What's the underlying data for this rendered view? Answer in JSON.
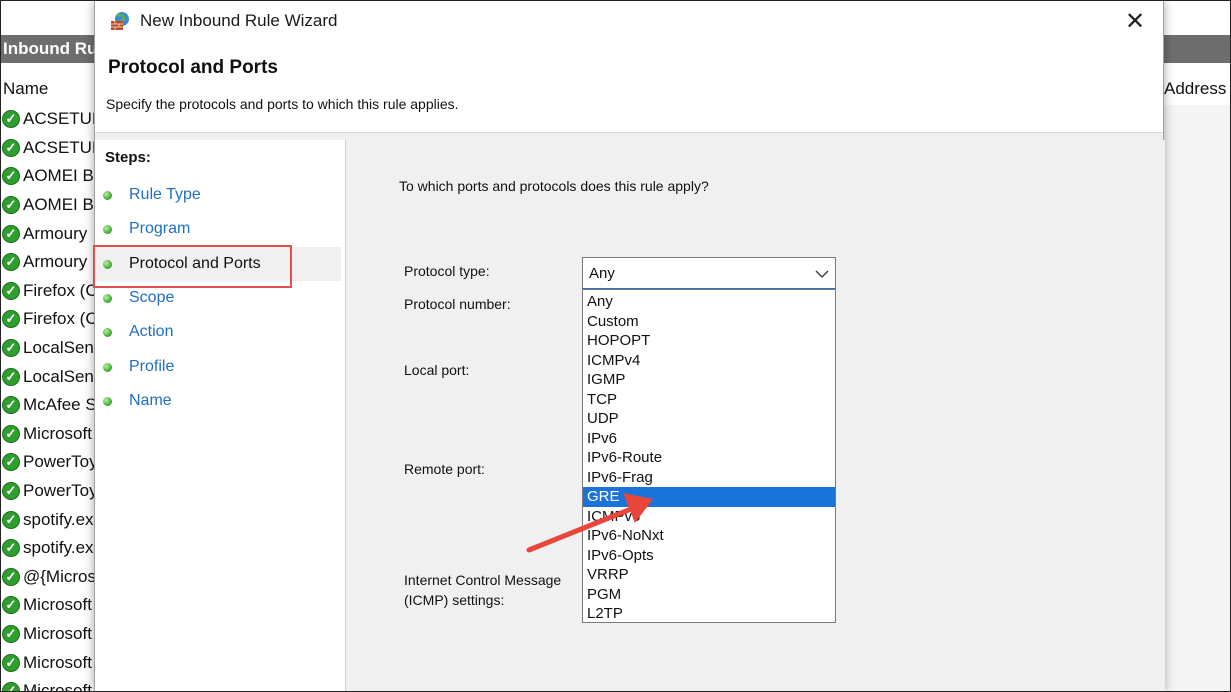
{
  "background": {
    "panel_title": "Inbound Ru",
    "columns": {
      "name": "Name",
      "address": "Address"
    },
    "rows": [
      "ACSETUP",
      "ACSETUP",
      "AOMEI Ba",
      "AOMEI Ba",
      "Armoury",
      "Armoury",
      "Firefox (C",
      "Firefox (C",
      "LocalSend",
      "LocalSend",
      "McAfee S",
      "Microsoft",
      "PowerToy",
      "PowerToy",
      "spotify.ex",
      "spotify.ex",
      "@{Micros",
      "Microsoft",
      "Microsoft",
      "Microsoft",
      "Microsoft"
    ],
    "check_icon": "check-shield-icon"
  },
  "dialog": {
    "window_title": "New Inbound Rule Wizard",
    "close_glyph": "✕",
    "page_title": "Protocol and Ports",
    "page_subtitle": "Specify the protocols and ports to which this rule applies."
  },
  "steps": {
    "title": "Steps:",
    "items": [
      "Rule Type",
      "Program",
      "Protocol and Ports",
      "Scope",
      "Action",
      "Profile",
      "Name"
    ],
    "current": "Protocol and Ports"
  },
  "main": {
    "question": "To which ports and protocols does this rule apply?",
    "labels": {
      "protocol_type": "Protocol type:",
      "protocol_number": "Protocol number:",
      "local_port": "Local port:",
      "remote_port": "Remote port:",
      "icmp_line1": "Internet Control Message",
      "icmp_line2": "(ICMP) settings:"
    },
    "protocol_select": {
      "value": "Any",
      "options": [
        "Any",
        "Custom",
        "HOPOPT",
        "ICMPv4",
        "IGMP",
        "TCP",
        "UDP",
        "IPv6",
        "IPv6-Route",
        "IPv6-Frag",
        "GRE",
        "ICMPv6",
        "IPv6-NoNxt",
        "IPv6-Opts",
        "VRRP",
        "PGM",
        "L2TP"
      ],
      "highlighted": "GRE"
    }
  },
  "colors": {
    "link": "#1f6fc5",
    "highlight": "#1a73d8",
    "annotation": "#e05050"
  }
}
